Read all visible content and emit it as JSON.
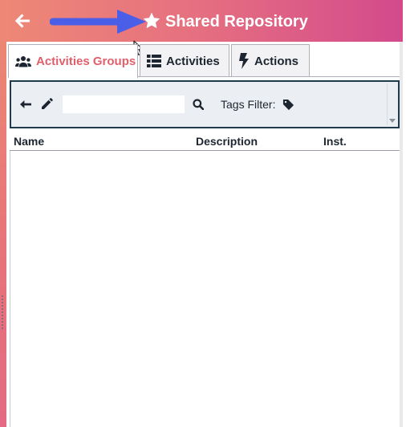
{
  "header": {
    "title": "Shared Repository",
    "back_icon": "arrow-left-icon",
    "title_icon": "star-icon",
    "annotation_icon": "blue-pointer-arrow-icon",
    "colors": {
      "gradient_start": "#ee8876",
      "gradient_end": "#d34a8c"
    }
  },
  "tabs": [
    {
      "label": "Activities Groups",
      "icon": "users-group-icon",
      "active": true
    },
    {
      "label": "Activities",
      "icon": "list-icon",
      "active": false
    },
    {
      "label": "Actions",
      "icon": "bolt-icon",
      "active": false
    }
  ],
  "toolbar": {
    "back_icon": "arrow-left-icon",
    "edit_icon": "pencil-icon",
    "search_value": "",
    "search_icon": "search-icon",
    "tags_filter_label": "Tags Filter:",
    "tag_icon": "tag-icon"
  },
  "grid": {
    "columns": [
      "Name",
      "Description",
      "Inst."
    ],
    "rows": []
  },
  "colors": {
    "active_tab_text": "#e15f6b",
    "annotation_arrow": "#4a5ee8"
  }
}
